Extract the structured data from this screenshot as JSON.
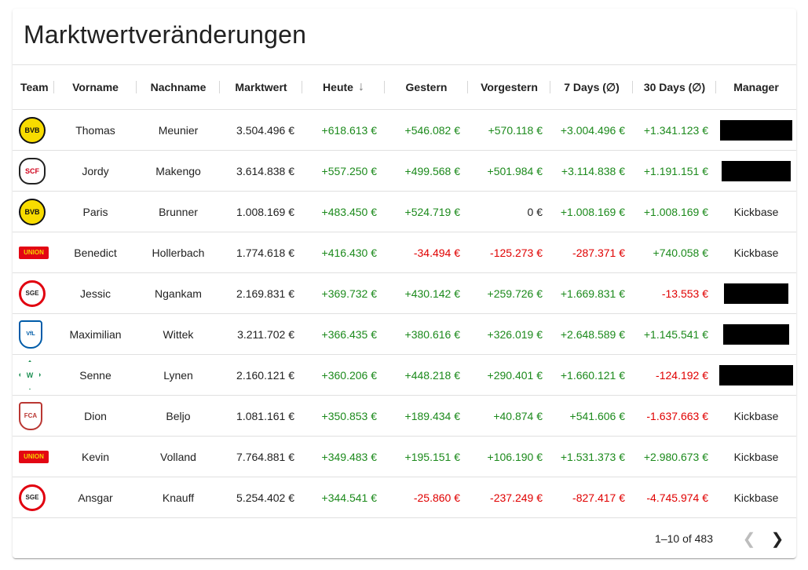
{
  "title": "Marktwertveränderungen",
  "columns": {
    "team": "Team",
    "vorname": "Vorname",
    "nachname": "Nachname",
    "marktwert": "Marktwert",
    "heute": "Heute",
    "gestern": "Gestern",
    "vorgestern": "Vorgestern",
    "days7": "7 Days (∅)",
    "days30": "30 Days (∅)",
    "manager": "Manager"
  },
  "sort": {
    "column": "Heute",
    "direction": "descending",
    "icon": "arrow-down-icon"
  },
  "rows": [
    {
      "team": "BVB",
      "vorname": "Thomas",
      "nachname": "Meunier",
      "marktwert": "3.504.496 €",
      "heute": "+618.613 €",
      "gestern": "+546.082 €",
      "vorgestern": "+570.118 €",
      "d7": "+3.004.496 €",
      "d30": "+1.341.123 €",
      "manager": "",
      "managerRedacted": true
    },
    {
      "team": "SCF",
      "vorname": "Jordy",
      "nachname": "Makengo",
      "marktwert": "3.614.838 €",
      "heute": "+557.250 €",
      "gestern": "+499.568 €",
      "vorgestern": "+501.984 €",
      "d7": "+3.114.838 €",
      "d30": "+1.191.151 €",
      "manager": "",
      "managerRedacted": true
    },
    {
      "team": "BVB",
      "vorname": "Paris",
      "nachname": "Brunner",
      "marktwert": "1.008.169 €",
      "heute": "+483.450 €",
      "gestern": "+524.719 €",
      "vorgestern": "0 €",
      "d7": "+1.008.169 €",
      "d30": "+1.008.169 €",
      "manager": "Kickbase",
      "managerRedacted": false
    },
    {
      "team": "FCU",
      "vorname": "Benedict",
      "nachname": "Hollerbach",
      "marktwert": "1.774.618 €",
      "heute": "+416.430 €",
      "gestern": "-34.494 €",
      "vorgestern": "-125.273 €",
      "d7": "-287.371 €",
      "d30": "+740.058 €",
      "manager": "Kickbase",
      "managerRedacted": false
    },
    {
      "team": "SGE",
      "vorname": "Jessic",
      "nachname": "Ngankam",
      "marktwert": "2.169.831 €",
      "heute": "+369.732 €",
      "gestern": "+430.142 €",
      "vorgestern": "+259.726 €",
      "d7": "+1.669.831 €",
      "d30": "-13.553 €",
      "manager": "",
      "managerRedacted": true
    },
    {
      "team": "VFL",
      "vorname": "Maximilian",
      "nachname": "Wittek",
      "marktwert": "3.211.702 €",
      "heute": "+366.435 €",
      "gestern": "+380.616 €",
      "vorgestern": "+326.019 €",
      "d7": "+2.648.589 €",
      "d30": "+1.145.541 €",
      "manager": "",
      "managerRedacted": true
    },
    {
      "team": "SVW",
      "vorname": "Senne",
      "nachname": "Lynen",
      "marktwert": "2.160.121 €",
      "heute": "+360.206 €",
      "gestern": "+448.218 €",
      "vorgestern": "+290.401 €",
      "d7": "+1.660.121 €",
      "d30": "-124.192 €",
      "manager": "",
      "managerRedacted": true
    },
    {
      "team": "FCA",
      "vorname": "Dion",
      "nachname": "Beljo",
      "marktwert": "1.081.161 €",
      "heute": "+350.853 €",
      "gestern": "+189.434 €",
      "vorgestern": "+40.874 €",
      "d7": "+541.606 €",
      "d30": "-1.637.663 €",
      "manager": "Kickbase",
      "managerRedacted": false
    },
    {
      "team": "FCU",
      "vorname": "Kevin",
      "nachname": "Volland",
      "marktwert": "7.764.881 €",
      "heute": "+349.483 €",
      "gestern": "+195.151 €",
      "vorgestern": "+106.190 €",
      "d7": "+1.531.373 €",
      "d30": "+2.980.673 €",
      "manager": "Kickbase",
      "managerRedacted": false
    },
    {
      "team": "SGE",
      "vorname": "Ansgar",
      "nachname": "Knauff",
      "marktwert": "5.254.402 €",
      "heute": "+344.541 €",
      "gestern": "-25.860 €",
      "vorgestern": "-237.249 €",
      "d7": "-827.417 €",
      "d30": "-4.745.974 €",
      "manager": "Kickbase",
      "managerRedacted": false
    }
  ],
  "pagination": {
    "label": "1–10 of 483",
    "prev_icon": "chevron-left-icon",
    "next_icon": "chevron-right-icon"
  },
  "colors": {
    "positive": "#1c8a1c",
    "negative": "#e00000",
    "text": "#212121",
    "divider": "#e0e0e0"
  }
}
